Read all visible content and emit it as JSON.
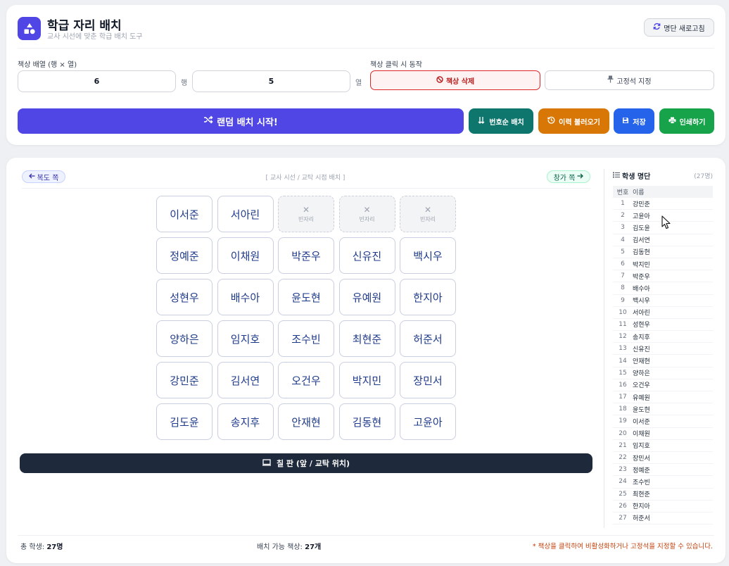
{
  "header": {
    "title": "학급 자리 배치",
    "subtitle": "교사 시선에 맞춘 학급 배치 도구",
    "refresh_label": "명단 새로고침"
  },
  "layout_settings": {
    "label": "책상 배열 (행 × 열)",
    "rows": "6",
    "rows_unit": "행",
    "cols": "5",
    "cols_unit": "열"
  },
  "click_mode": {
    "label": "책상 클릭 시 동작",
    "delete_label": "책상 삭제",
    "fixed_label": "고정석 지정"
  },
  "actions": {
    "random": "랜덤 배치 시작!",
    "by_number": "번호순 배치",
    "history": "이력 불러오기",
    "save": "저장",
    "print": "인쇄하기"
  },
  "classroom": {
    "left_side": "복도 쪽",
    "right_side": "창가 쪽",
    "view_label": "[ 교사 시선 / 교탁 시점 배치 ]",
    "empty_label": "빈자리",
    "board_label": "칠 판 (앞 / 교탁 위치)",
    "seats": [
      [
        "이서준",
        "서아린",
        null,
        null,
        null
      ],
      [
        "정예준",
        "이채원",
        "박준우",
        "신유진",
        "백시우"
      ],
      [
        "성현우",
        "배수아",
        "윤도현",
        "유예원",
        "한지아"
      ],
      [
        "양하은",
        "임지호",
        "조수빈",
        "최현준",
        "허준서"
      ],
      [
        "강민준",
        "김서연",
        "오건우",
        "박지민",
        "장민서"
      ],
      [
        "김도윤",
        "송지후",
        "안재현",
        "김동현",
        "고윤아"
      ]
    ]
  },
  "roster": {
    "title": "학생 명단",
    "count": "(27명)",
    "col_no": "번호",
    "col_name": "이름",
    "students": [
      {
        "no": "1",
        "name": "강민준"
      },
      {
        "no": "2",
        "name": "고윤아"
      },
      {
        "no": "3",
        "name": "김도윤"
      },
      {
        "no": "4",
        "name": "김서연"
      },
      {
        "no": "5",
        "name": "김동현"
      },
      {
        "no": "6",
        "name": "박지민"
      },
      {
        "no": "7",
        "name": "박준우"
      },
      {
        "no": "8",
        "name": "배수아"
      },
      {
        "no": "9",
        "name": "백시우"
      },
      {
        "no": "10",
        "name": "서아린"
      },
      {
        "no": "11",
        "name": "성현우"
      },
      {
        "no": "12",
        "name": "송지후"
      },
      {
        "no": "13",
        "name": "신유진"
      },
      {
        "no": "14",
        "name": "안재현"
      },
      {
        "no": "15",
        "name": "양하은"
      },
      {
        "no": "16",
        "name": "오건우"
      },
      {
        "no": "17",
        "name": "유예원"
      },
      {
        "no": "18",
        "name": "윤도현"
      },
      {
        "no": "19",
        "name": "이서준"
      },
      {
        "no": "20",
        "name": "이채원"
      },
      {
        "no": "21",
        "name": "임지호"
      },
      {
        "no": "22",
        "name": "장민서"
      },
      {
        "no": "23",
        "name": "정예준"
      },
      {
        "no": "24",
        "name": "조수빈"
      },
      {
        "no": "25",
        "name": "최현준"
      },
      {
        "no": "26",
        "name": "한지아"
      },
      {
        "no": "27",
        "name": "허준서"
      }
    ]
  },
  "footer": {
    "total_label": "총 학생:",
    "total_value": "27명",
    "available_label": "배치 가능 책상:",
    "available_value": "27개",
    "note": "* 책상을 클릭하여 비활성화하거나 고정석을 지정할 수 있습니다."
  },
  "icons": {
    "logo": "shapes-icon",
    "refresh": "refresh-icon",
    "delete": "ban-icon",
    "fixed": "pin-icon",
    "random": "shuffle-icon",
    "by_number": "sort-numeric-icon",
    "history": "history-icon",
    "save": "save-icon",
    "print": "printer-icon",
    "board": "chalkboard-icon",
    "roster": "list-ol-icon"
  },
  "colors": {
    "primary": "#4f46e5",
    "teal": "#0f766e",
    "amber": "#d97706",
    "blue": "#2563eb",
    "green": "#16a34a",
    "danger": "#dc2626",
    "board": "#1e293b"
  }
}
